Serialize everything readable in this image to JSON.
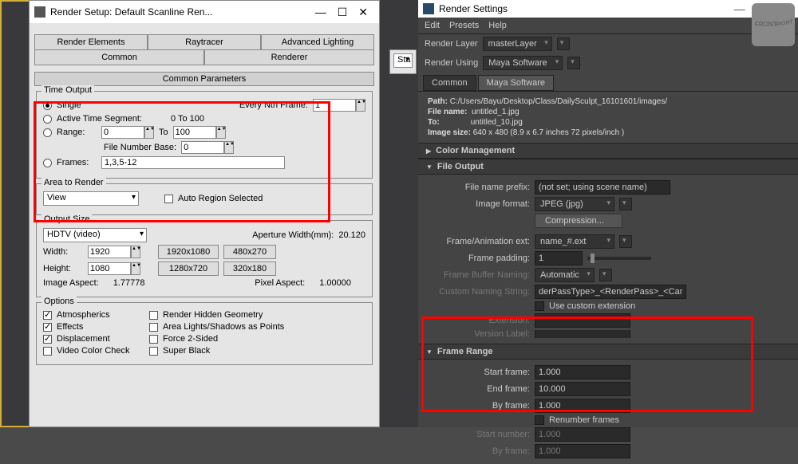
{
  "max": {
    "title": "Render Setup: Default Scanline Ren...",
    "controls": {
      "min": "—",
      "restore": "☐",
      "close": "✕"
    },
    "tabs": {
      "render_elements": "Render Elements",
      "raytracer": "Raytracer",
      "advanced_lighting": "Advanced Lighting",
      "common": "Common",
      "renderer": "Renderer"
    },
    "rollup_common_params": "Common Parameters",
    "time_output": {
      "title": "Time Output",
      "single": "Single",
      "every_nth_label": "Every Nth Frame:",
      "every_nth_value": "1",
      "active_segment": "Active Time Segment:",
      "active_segment_range": "0 To 100",
      "range_label": "Range:",
      "range_from": "0",
      "range_to": "100",
      "to_label": "To",
      "file_number_base_label": "File Number Base:",
      "file_number_base_value": "0",
      "frames_label": "Frames:",
      "frames_value": "1,3,5-12"
    },
    "area_to_render": {
      "title": "Area to Render",
      "view": "View",
      "auto_region": "Auto Region Selected"
    },
    "output_size": {
      "title": "Output Size",
      "preset": "HDTV (video)",
      "aperture_label": "Aperture Width(mm):",
      "aperture_value": "20.120",
      "width_label": "Width:",
      "width_value": "1920",
      "height_label": "Height:",
      "height_value": "1080",
      "btn_1920": "1920x1080",
      "btn_480": "480x270",
      "btn_1280": "1280x720",
      "btn_320": "320x180",
      "image_aspect_label": "Image Aspect:",
      "image_aspect_value": "1.77778",
      "pixel_aspect_label": "Pixel Aspect:",
      "pixel_aspect_value": "1.00000"
    },
    "options": {
      "title": "Options",
      "atmospherics": "Atmospherics",
      "render_hidden": "Render Hidden Geometry",
      "effects": "Effects",
      "area_lights": "Area Lights/Shadows as Points",
      "displacement": "Displacement",
      "force_2sided": "Force 2-Sided",
      "video_color": "Video Color Check",
      "super_black": "Super Black"
    }
  },
  "maya": {
    "title": "Render Settings",
    "controls": {
      "min": "—",
      "restore": "☐",
      "close": "✕"
    },
    "menu": {
      "edit": "Edit",
      "presets": "Presets",
      "help": "Help"
    },
    "render_layer_label": "Render Layer",
    "render_layer_value": "masterLayer",
    "render_using_label": "Render Using",
    "render_using_value": "Maya Software",
    "tabs": {
      "common": "Common",
      "software": "Maya Software"
    },
    "info": {
      "path_label": "Path:",
      "path_value": "C:/Users/Bayu/Desktop/Class/DailySculpt_16101601/images/",
      "file_label": "File name:",
      "file_value": "untitled_1.jpg",
      "to_label": "To:",
      "to_value": "untitled_10.jpg",
      "size_label": "Image size:",
      "size_value": "640 x 480 (8.9 x 6.7 inches 72 pixels/inch )"
    },
    "sections": {
      "color_mgmt": "Color Management",
      "file_output": "File Output",
      "frame_range": "Frame Range"
    },
    "file_output": {
      "prefix_label": "File name prefix:",
      "prefix_value": "(not set; using scene name)",
      "format_label": "Image format:",
      "format_value": "JPEG (jpg)",
      "compression": "Compression...",
      "frame_ext_label": "Frame/Animation ext:",
      "frame_ext_value": "name_#.ext",
      "padding_label": "Frame padding:",
      "padding_value": "1",
      "buffer_label": "Frame Buffer Naming:",
      "buffer_value": "Automatic",
      "custom_naming_label": "Custom Naming String:",
      "custom_naming_value": "derPassType>_<RenderPass>_<Camera>",
      "use_custom_ext": "Use custom extension",
      "extension_label": "Extension:",
      "version_label": "Version Label:"
    },
    "frame_range": {
      "start_label": "Start frame:",
      "start_value": "1.000",
      "end_label": "End frame:",
      "end_value": "10.000",
      "by_label": "By frame:",
      "by_value": "1.000",
      "renumber": "Renumber frames",
      "start_number_label": "Start number:",
      "start_number_value": "1.000",
      "by_frame2_label": "By frame:",
      "by_frame2_value": "1.000"
    }
  },
  "snippet": {
    "sta": "Sta"
  }
}
